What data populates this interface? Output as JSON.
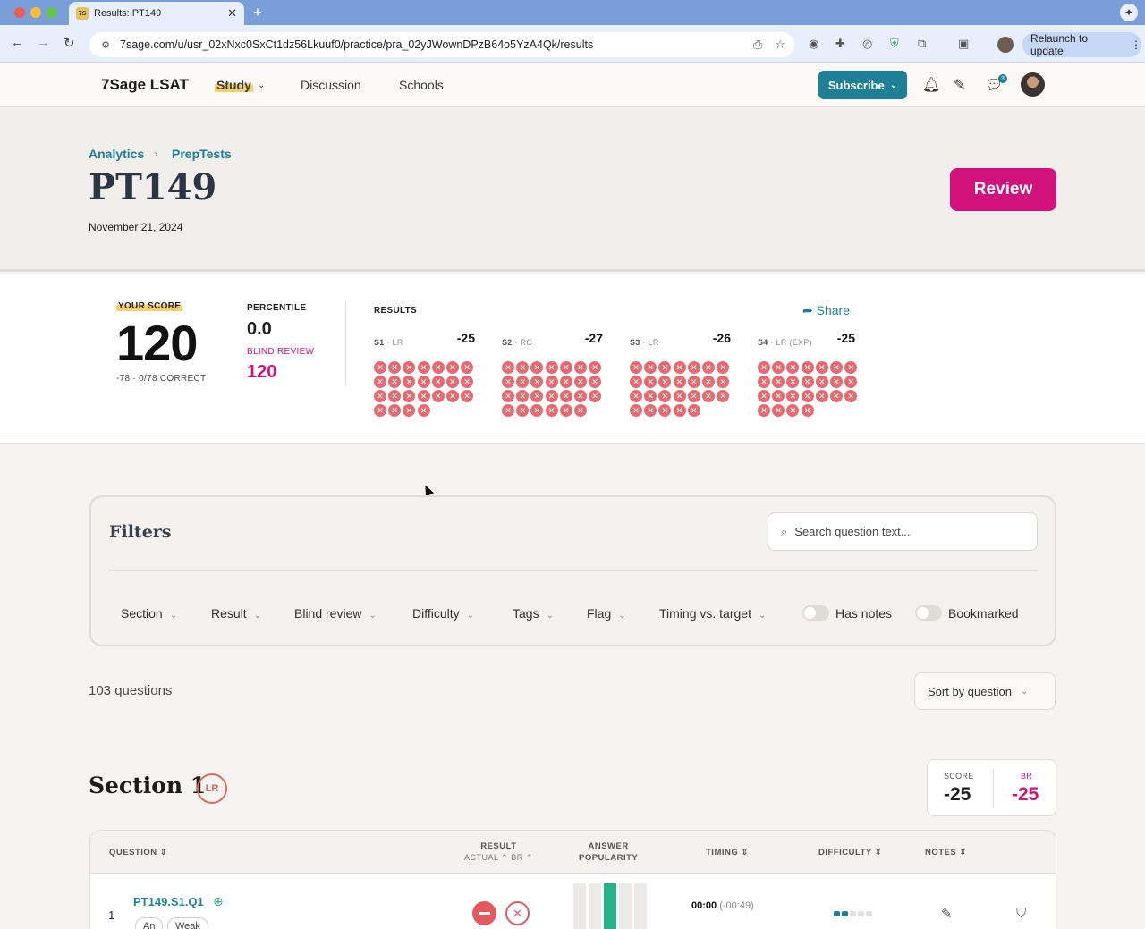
{
  "browser": {
    "tab_favicon": "7S",
    "tab_title": "Results: PT149",
    "url": "7sage.com/u/usr_02xNxc0SxCt1dz56Lkuuf0/practice/pra_02yJWownDPzB64o5YzA4Qk/results",
    "relaunch_label": "Relaunch to update"
  },
  "header": {
    "logo": "7Sage LSAT",
    "nav": [
      "Study",
      "Discussion",
      "Schools"
    ],
    "subscribe_label": "Subscribe",
    "message_badge": "3"
  },
  "hero": {
    "breadcrumb": [
      "Analytics",
      "PrepTests"
    ],
    "title": "PT149",
    "date": "November 21, 2024",
    "review_label": "Review"
  },
  "score": {
    "your_score_label": "YOUR SCORE",
    "your_score": "120",
    "correct_summary": "-78 · 0/78 CORRECT",
    "percentile_label": "PERCENTILE",
    "percentile": "0.0",
    "blind_review_label": "BLIND REVIEW",
    "blind_review": "120",
    "results_label": "RESULTS",
    "share_label": "Share",
    "sections": [
      {
        "id": "S1",
        "type": "LR",
        "score": "-25",
        "count": 25
      },
      {
        "id": "S2",
        "type": "RC",
        "score": "-27",
        "count": 27
      },
      {
        "id": "S3",
        "type": "LR",
        "score": "-26",
        "count": 26
      },
      {
        "id": "S4",
        "type": "LR (EXP)",
        "score": "-25",
        "count": 25
      }
    ]
  },
  "filters": {
    "title": "Filters",
    "search_placeholder": "Search question text...",
    "dropdowns": [
      "Section",
      "Result",
      "Blind review",
      "Difficulty",
      "Tags",
      "Flag",
      "Timing vs. target"
    ],
    "toggles": [
      "Has notes",
      "Bookmarked"
    ]
  },
  "list": {
    "question_count": "103 questions",
    "sort_label": "Sort by question"
  },
  "section1": {
    "title": "Section 1",
    "badge": "LR",
    "score_label": "SCORE",
    "score": "-25",
    "br_label": "BR",
    "br_score": "-25",
    "columns": {
      "question": "QUESTION",
      "result": "RESULT",
      "result_sub": "ACTUAL ⌃ BR ⌃",
      "answer": "ANSWER",
      "answer_sub": "POPULARITY",
      "timing": "TIMING",
      "difficulty": "DIFFICULTY",
      "notes": "NOTES"
    },
    "row": {
      "number": "1",
      "id": "PT149.S1.Q1",
      "tags": [
        "An",
        "Weak"
      ],
      "timing": "00:00",
      "timing_delta": "(-00:49)",
      "difficulty_level": 2,
      "answer_popularity_highlight": 3
    }
  },
  "colors": {
    "teal": "#1f7f94",
    "magenta": "#d1127a",
    "wrong_red": "#e36b72"
  }
}
